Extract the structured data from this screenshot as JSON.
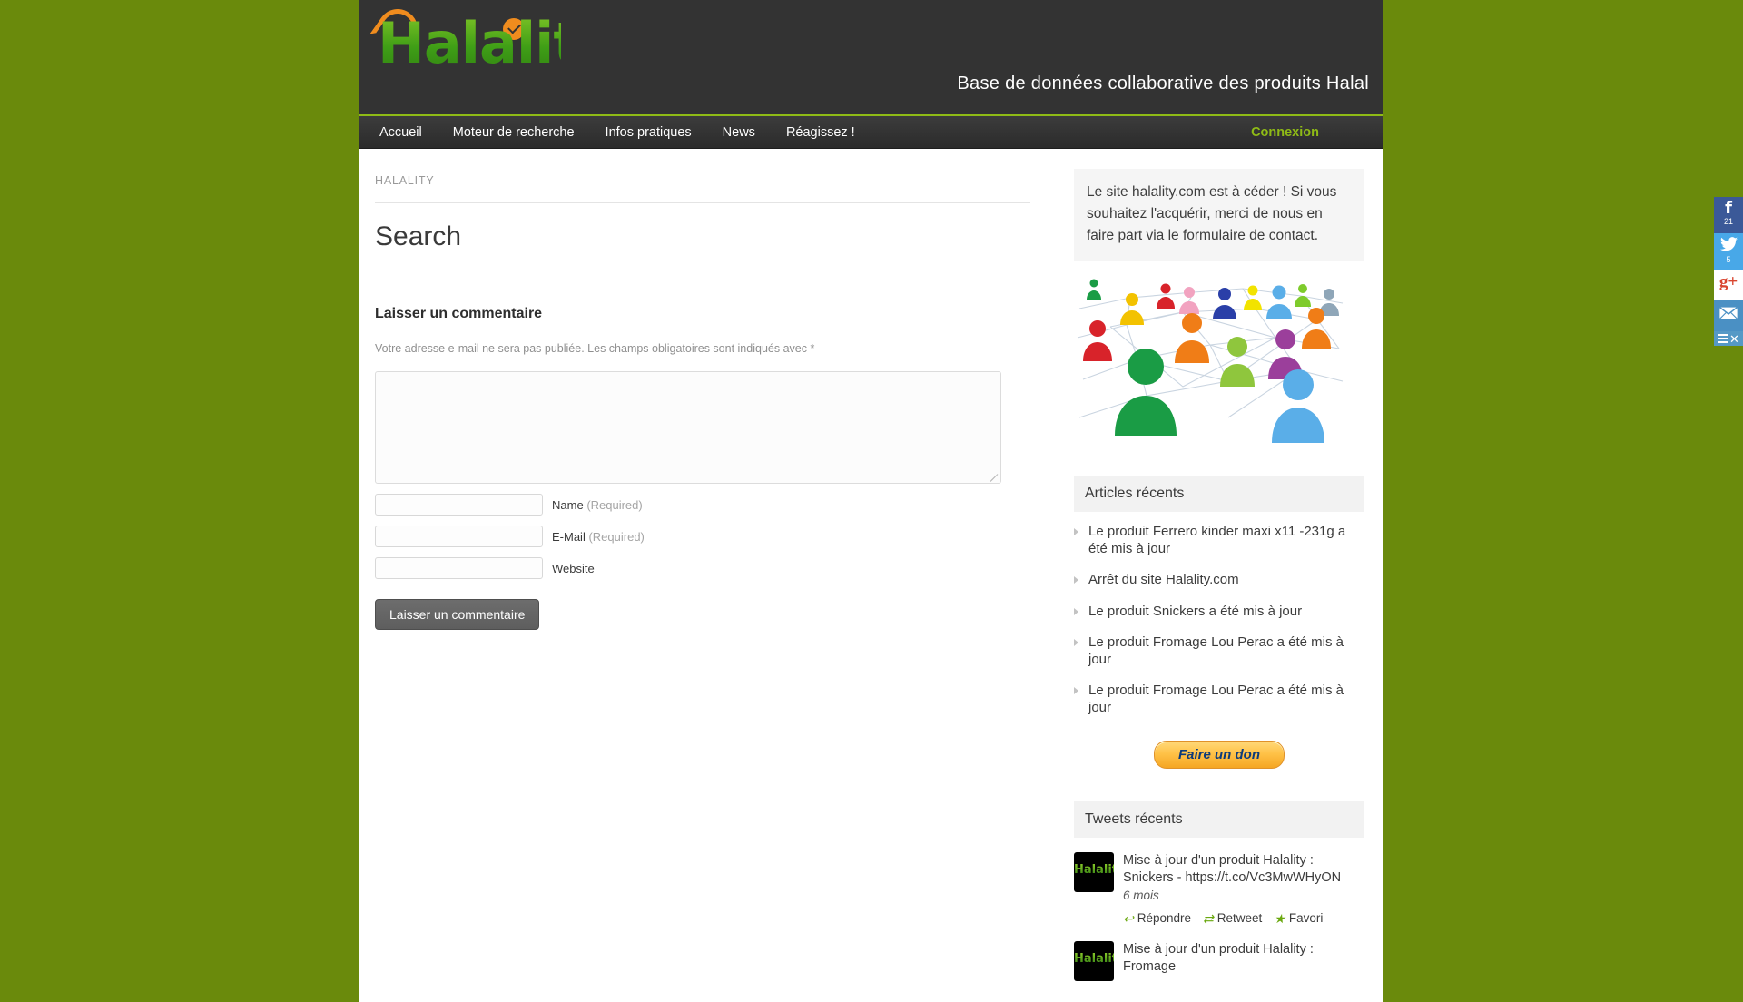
{
  "site": {
    "logo_text": "Halality",
    "tagline": "Base de données collaborative des produits Halal",
    "bg_color": "#6a8a0c",
    "accent_green": "#8fbb16",
    "header_bg": "#333333"
  },
  "nav": {
    "items": [
      {
        "label": "Accueil"
      },
      {
        "label": "Moteur de recherche"
      },
      {
        "label": "Infos pratiques"
      },
      {
        "label": "News"
      },
      {
        "label": "Réagissez !"
      }
    ],
    "login_label": "Connexion"
  },
  "main": {
    "breadcrumb": "HALALITY",
    "page_title": "Search",
    "comment_form": {
      "heading": "Laisser un commentaire",
      "note": "Votre adresse e-mail ne sera pas publiée. Les champs obligatoires sont indiqués avec *",
      "textarea_value": "",
      "fields": [
        {
          "name": "name",
          "value": "",
          "label": "Name",
          "required_text": "(Required)"
        },
        {
          "name": "email",
          "value": "",
          "label": "E-Mail",
          "required_text": "(Required)"
        },
        {
          "name": "website",
          "value": "",
          "label": "Website",
          "required_text": ""
        }
      ],
      "submit_label": "Laisser un commentaire"
    }
  },
  "sidebar": {
    "notice": "Le site halality.com est à céder ! Si vous souhaitez l'acquérir, merci de nous en faire part via le formulaire de contact.",
    "image_alt": "network-of-people-illustration",
    "recent_posts": {
      "title": "Articles récents",
      "items": [
        {
          "label": "Le produit Ferrero kinder maxi x11 -231g a été mis à jour"
        },
        {
          "label": "Arrêt du site Halality.com"
        },
        {
          "label": "Le produit Snickers a été mis à jour"
        },
        {
          "label": "Le produit Fromage Lou Perac a été mis à jour"
        },
        {
          "label": "Le produit Fromage Lou Perac a été mis à jour"
        }
      ]
    },
    "donate_label": "Faire un don",
    "tweets": {
      "title": "Tweets récents",
      "items": [
        {
          "avatar_text": "Halality",
          "text": "Mise à jour d'un produit Halality : Snickers - https://t.co/Vc3MwWHyON",
          "time": "6 mois",
          "reply_label": "Répondre",
          "retweet_label": "Retweet",
          "favorite_label": "Favori"
        },
        {
          "avatar_text": "Halality",
          "text": "Mise à jour d'un produit Halality : Fromage",
          "time": "",
          "reply_label": "",
          "retweet_label": "",
          "favorite_label": ""
        }
      ]
    }
  },
  "social_rail": {
    "facebook": {
      "glyph": "f",
      "count": "21",
      "color": "#3b5998"
    },
    "twitter": {
      "glyph": "ᴠ",
      "count": "5",
      "color": "#48a8e8"
    },
    "googleplus": {
      "glyph": "g+",
      "color": "#d9452f"
    },
    "email": {
      "glyph": "✉"
    },
    "toggle": {
      "close_glyph": "✕"
    }
  }
}
